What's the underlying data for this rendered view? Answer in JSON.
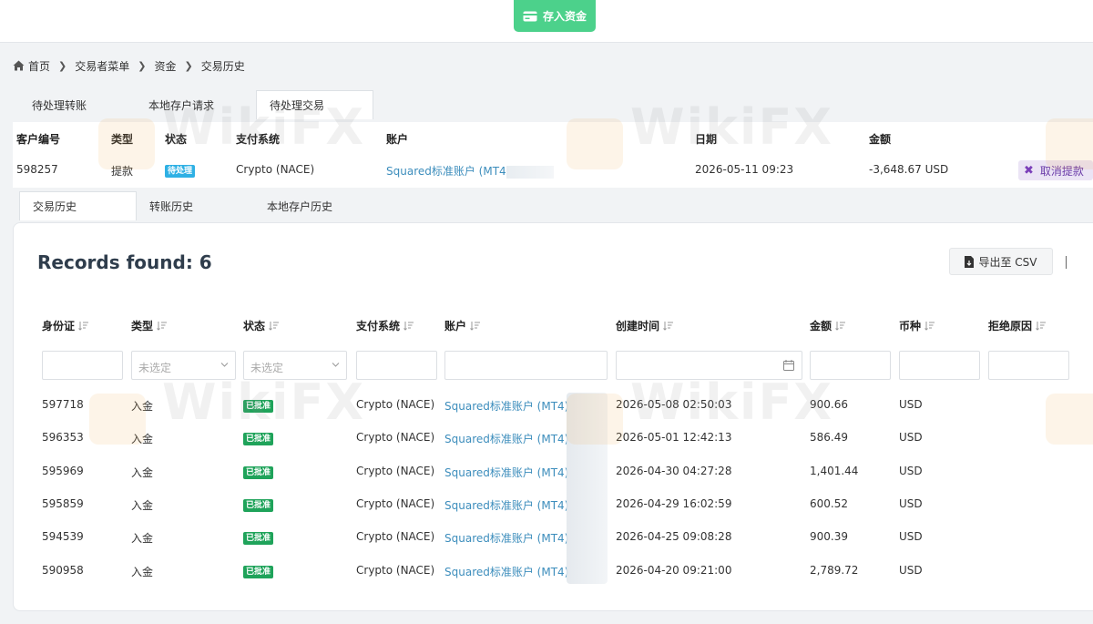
{
  "topbar": {
    "deposit_label": "存入资金",
    "deposit_icon": "credit-card-icon"
  },
  "breadcrumb": {
    "items": [
      "首页",
      "交易者菜单",
      "资金",
      "交易历史"
    ]
  },
  "pending_tabs": [
    "待处理转账",
    "本地存户请求",
    "待处理交易"
  ],
  "pending_table": {
    "headers": [
      "客户编号",
      "类型",
      "状态",
      "支付系统",
      "账户",
      "日期",
      "金额"
    ],
    "row": {
      "id": "598257",
      "type": "提款",
      "status": "待处理",
      "payment": "Crypto (NACE)",
      "account": "Squared标准账户 (MT4",
      "date": "2026-05-11 09:23",
      "amount": "-3,648.67 USD",
      "cancel_label": "取消提款"
    }
  },
  "history_tabs": [
    "交易历史",
    "转账历史",
    "本地存户历史"
  ],
  "records": {
    "title": "Records found: 6",
    "export_label": "导出至 CSV",
    "headers": [
      "身份证",
      "类型",
      "状态",
      "支付系统",
      "账户",
      "创建时间",
      "金额",
      "币种",
      "拒绝原因"
    ],
    "filter_placeholder": "未选定",
    "rows": [
      {
        "id": "597718",
        "type": "入金",
        "status": "已批准",
        "payment": "Crypto (NACE)",
        "account": "Squared标准账户 (MT4)",
        "created": "2026-05-08 02:50:03",
        "amount": "900.66",
        "currency": "USD"
      },
      {
        "id": "596353",
        "type": "入金",
        "status": "已批准",
        "payment": "Crypto (NACE)",
        "account": "Squared标准账户 (MT4)",
        "created": "2026-05-01 12:42:13",
        "amount": "586.49",
        "currency": "USD"
      },
      {
        "id": "595969",
        "type": "入金",
        "status": "已批准",
        "payment": "Crypto (NACE)",
        "account": "Squared标准账户 (MT4)",
        "created": "2026-04-30 04:27:28",
        "amount": "1,401.44",
        "currency": "USD"
      },
      {
        "id": "595859",
        "type": "入金",
        "status": "已批准",
        "payment": "Crypto (NACE)",
        "account": "Squared标准账户 (MT4)",
        "created": "2026-04-29 16:02:59",
        "amount": "600.52",
        "currency": "USD"
      },
      {
        "id": "594539",
        "type": "入金",
        "status": "已批准",
        "payment": "Crypto (NACE)",
        "account": "Squared标准账户 (MT4)",
        "created": "2026-04-25 09:08:28",
        "amount": "900.39",
        "currency": "USD"
      },
      {
        "id": "590958",
        "type": "入金",
        "status": "已批准",
        "payment": "Crypto (NACE)",
        "account": "Squared标准账户 (MT4)",
        "created": "2026-04-20 09:21:00",
        "amount": "2,789.72",
        "currency": "USD"
      }
    ]
  },
  "watermark": {
    "text": "WikiFX"
  },
  "colors": {
    "accent_green": "#4cd18b",
    "link": "#3c8dbc",
    "approved": "#1fa35a",
    "pending": "#2eb0e4",
    "cancel": "#6a3aa8"
  }
}
